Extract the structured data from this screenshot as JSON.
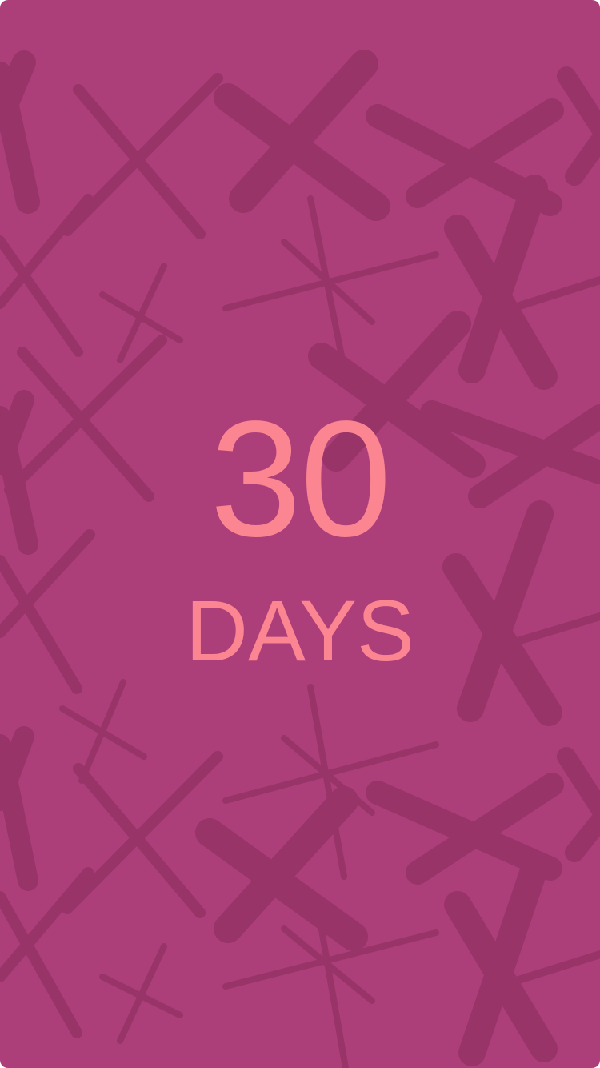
{
  "screen": {
    "background_color": "#ac3f7a",
    "pattern_color": "#983468",
    "text_color": "#fb8591",
    "pattern_icon": "brush-x-icon"
  },
  "streak": {
    "number": "30",
    "unit": "DAYS"
  }
}
